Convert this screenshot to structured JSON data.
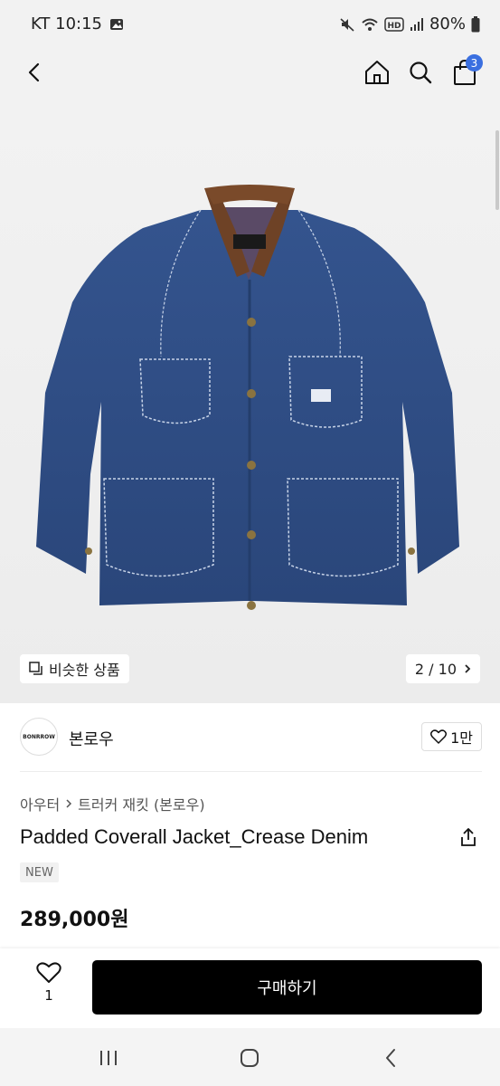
{
  "status_bar": {
    "carrier_time": "KT 10:15",
    "battery": "80%"
  },
  "header": {
    "cart_count": "3"
  },
  "gallery": {
    "similar_label": "비슷한 상품",
    "page_indicator": "2 / 10"
  },
  "brand": {
    "logo_text": "BONRROW",
    "name": "본로우",
    "like_count": "1만"
  },
  "product": {
    "breadcrumb": [
      "아우터",
      "트러커 재킷 (본로우)"
    ],
    "title": "Padded Coverall Jacket_Crease Denim",
    "badge": "NEW",
    "price": "289,000원"
  },
  "actions": {
    "wish_count": "1",
    "buy_label": "구매하기"
  },
  "colors": {
    "accent_badge": "#3a6fe0",
    "buy_button": "#000000",
    "denim": "#2f4f86"
  }
}
